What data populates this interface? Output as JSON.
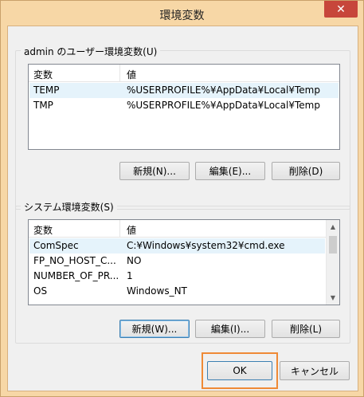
{
  "window": {
    "title": "環境変数",
    "close_glyph": "✕"
  },
  "user_vars": {
    "group_title": "admin のユーザー環境変数(U)",
    "headers": [
      "変数",
      "値"
    ],
    "rows": [
      {
        "name": "TEMP",
        "value": "%USERPROFILE%¥AppData¥Local¥Temp"
      },
      {
        "name": "TMP",
        "value": "%USERPROFILE%¥AppData¥Local¥Temp"
      }
    ],
    "buttons": {
      "new": "新規(N)...",
      "edit": "編集(E)...",
      "delete": "削除(D)"
    }
  },
  "system_vars": {
    "group_title": "システム環境変数(S)",
    "headers": [
      "変数",
      "値"
    ],
    "rows": [
      {
        "name": "ComSpec",
        "value": "C:¥Windows¥system32¥cmd.exe"
      },
      {
        "name": "FP_NO_HOST_C...",
        "value": "NO"
      },
      {
        "name": "NUMBER_OF_PR...",
        "value": "1"
      },
      {
        "name": "OS",
        "value": "Windows_NT"
      }
    ],
    "buttons": {
      "new": "新規(W)...",
      "edit": "編集(I)...",
      "delete": "削除(L)"
    }
  },
  "footer": {
    "ok": "OK",
    "cancel": "キャンセル"
  },
  "colors": {
    "frame": "#f7d7a6",
    "close": "#c7463b",
    "selection": "#e5f3fb",
    "highlight": "#ef8a36"
  }
}
